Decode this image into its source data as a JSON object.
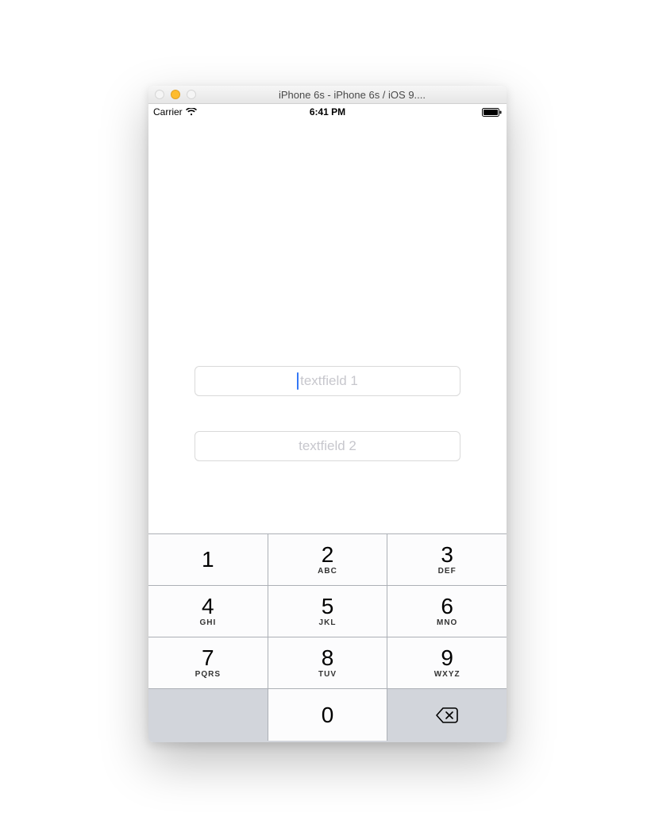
{
  "window": {
    "title": "iPhone 6s - iPhone 6s / iOS 9...."
  },
  "statusbar": {
    "carrier": "Carrier",
    "time": "6:41 PM"
  },
  "fields": {
    "tf1": {
      "placeholder": "textfield 1"
    },
    "tf2": {
      "placeholder": "textfield 2"
    }
  },
  "keypad": {
    "keys": [
      [
        {
          "n": "1",
          "s": ""
        },
        {
          "n": "2",
          "s": "ABC"
        },
        {
          "n": "3",
          "s": "DEF"
        }
      ],
      [
        {
          "n": "4",
          "s": "GHI"
        },
        {
          "n": "5",
          "s": "JKL"
        },
        {
          "n": "6",
          "s": "MNO"
        }
      ],
      [
        {
          "n": "7",
          "s": "PQRS"
        },
        {
          "n": "8",
          "s": "TUV"
        },
        {
          "n": "9",
          "s": "WXYZ"
        }
      ],
      [
        {
          "n": "",
          "s": ""
        },
        {
          "n": "0",
          "s": ""
        },
        {
          "n": "",
          "s": ""
        }
      ]
    ]
  }
}
